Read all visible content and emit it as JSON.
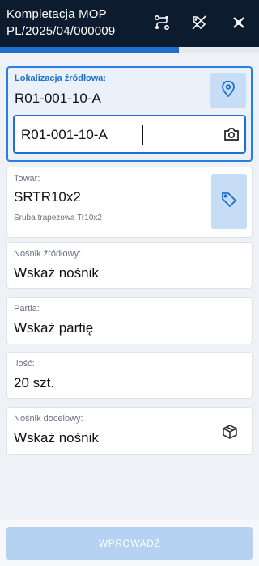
{
  "header": {
    "title_line1": "Kompletacja MOP",
    "title_line2": "PL/2025/04/000009",
    "icons": [
      "route-icon",
      "tag-off-icon",
      "close-icon"
    ]
  },
  "progress": {
    "value_percent": 69,
    "fill_color": "#1f6fcf"
  },
  "source_location": {
    "label": "Lokalizacja źródłowa:",
    "value": "R01-001-10-A",
    "input_value": "R01-001-10-A",
    "icons": [
      "location-pin-icon",
      "camera-icon"
    ]
  },
  "product": {
    "label": "Towar:",
    "value": "SRTR10x2",
    "description": "Śruba trapezowa Tr10x2",
    "icon": "tag-icon"
  },
  "source_carrier": {
    "label": "Nośnik źródłowy:",
    "value": "Wskaż nośnik"
  },
  "batch": {
    "label": "Partia:",
    "value": "Wskaż partię"
  },
  "quantity": {
    "label": "Ilość:",
    "value": "20 szt."
  },
  "target_carrier": {
    "label": "Nośnik docelowy:",
    "value": "Wskaż nośnik",
    "icon": "package-icon"
  },
  "footer": {
    "submit_label": "WPROWADŹ"
  },
  "colors": {
    "accent": "#1f6fcf",
    "header_bg": "#0d1b2e",
    "icon_bg": "#c7dcf5"
  }
}
